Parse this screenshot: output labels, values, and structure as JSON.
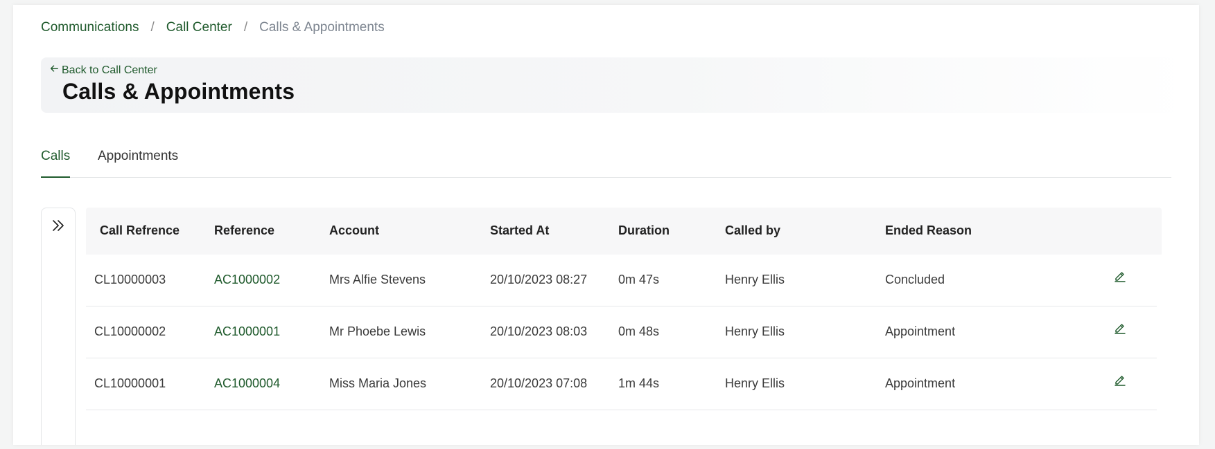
{
  "breadcrumb": {
    "items": [
      {
        "label": "Communications"
      },
      {
        "label": "Call Center"
      }
    ],
    "separator": "/",
    "current": "Calls & Appointments"
  },
  "header": {
    "back_label": "Back to Call Center",
    "title": "Calls & Appointments"
  },
  "tabs": [
    {
      "label": "Calls",
      "active": true
    },
    {
      "label": "Appointments",
      "active": false
    }
  ],
  "table": {
    "columns": [
      "Call Refrence",
      "Reference",
      "Account",
      "Started At",
      "Duration",
      "Called by",
      "Ended Reason"
    ],
    "rows": [
      {
        "call_ref": "CL10000003",
        "reference": "AC1000002",
        "account": "Mrs Alfie Stevens",
        "started_at": "20/10/2023 08:27",
        "duration": "0m 47s",
        "called_by": "Henry Ellis",
        "ended_reason": "Concluded"
      },
      {
        "call_ref": "CL10000002",
        "reference": "AC1000001",
        "account": "Mr Phoebe Lewis",
        "started_at": "20/10/2023 08:03",
        "duration": "0m 48s",
        "called_by": "Henry Ellis",
        "ended_reason": "Appointment"
      },
      {
        "call_ref": "CL10000001",
        "reference": "AC1000004",
        "account": "Miss Maria Jones",
        "started_at": "20/10/2023 07:08",
        "duration": "1m 44s",
        "called_by": "Henry Ellis",
        "ended_reason": "Appointment"
      }
    ]
  },
  "icons": {
    "back": "arrow-left-icon",
    "sidebar_toggle": "double-chevron-right-icon",
    "edit": "pencil-icon"
  },
  "colors": {
    "accent": "#1f5a2c",
    "muted_text": "#7d8590",
    "header_bg": "#f7f7f8"
  }
}
